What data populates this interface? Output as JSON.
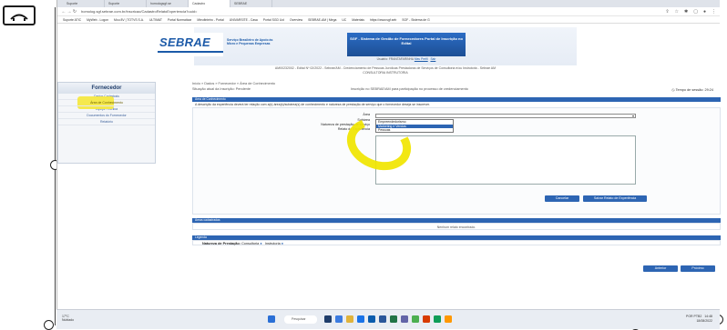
{
  "browser": {
    "tabs": [
      "Suporte",
      "Suporte",
      "homologsgf.se",
      "Cadastro",
      "SEBRAE"
    ],
    "url": "homolog.sgf.sebrae.com.br/inscricao/CadastroRelatoExperiencia?uuid=",
    "bookmarks": [
      "Suporte ATIC",
      "MyWeb - Logon",
      "Mou 8V | TOTVS S.A.",
      "ULTIMAT",
      "Portal Normatizar",
      "Mieufinteiro - Portal",
      "UNIVARSITE - Casa",
      "Portal SGD Uol",
      "Overview",
      "SEBRAE-AM | Mega",
      "UC",
      "Materiais",
      "https://www.sgf.seb",
      "SGF - Sistema de G"
    ]
  },
  "header": {
    "logo": "SEBRAE",
    "logo_tagline": "Serviço Brasileiro de Apoio às Micro e Pequenas Empresas",
    "sgf_title": "SGF - Sistema de Gestão de Fornecedores Portal de Inscrição no Edital",
    "user_label": "Usuário: FRANTAFARINHA",
    "user_link": "Meu Perfil",
    "exit_link": "Sair",
    "edital": "AM00232002 - Edital Nº 02/2022 - Sebrae/AM - Credenciamento de Pessoas Jurídicas Prestadoras de Serviços de Consultoria e/ou Instrutoria - Sebrae AM",
    "edital_sub": "CONSULTORIA INSTRUTORIA"
  },
  "sidebar": {
    "title": "Fornecedor",
    "items": [
      "Dados Cadastrais",
      "Área de Conhecimento",
      "Equipe Técnica",
      "Documentos do Fornecedor",
      "Relatório"
    ]
  },
  "content": {
    "breadcrumb": "Início » Dados » Fornecedor » Área de Conhecimento",
    "status": "Situação atual da Inscrição: Pendente",
    "status_mid": "Inscrição no SEBRAE/AM para participação no processo de credenciamento",
    "timer": "Tempo de sessão: 29:24",
    "section_title": "Área de Conhecimento",
    "section_desc": "A descrição da experiência deverá ter relação com a(s) área(s)/subárea(s) de conhecimento e natureza de prestação de serviço que o fornecedor deseja se inscrever.",
    "labels": {
      "area": "Área",
      "subarea": "Subárea",
      "natureza": "Natureza de prestação de serviço",
      "relato": "Relato de Experiência"
    },
    "options": [
      "Empreendedorismo",
      "Marketing e Vendas",
      "Pessoas"
    ],
    "selected_option": "Marketing e Vendas",
    "cancel_label": "Cancelar",
    "save_label": "Salvar Relato de Experiência",
    "list_title": "Áreas cadastradas",
    "no_results": "Nenhum relato encontrado.",
    "legend_title": "Legenda",
    "legend_text": "Natureza de Prestação:",
    "legend_consultoria": "Consultoria",
    "legend_instrutoria": "Instrutoria",
    "prev_label": "Anterior",
    "next_label": "Próximo"
  },
  "taskbar": {
    "weather_temp": "17°C",
    "weather_desc": "Nublado",
    "search_label": "Pesquisar",
    "lang": "POR PTB2",
    "time": "14:48",
    "date": "18/08/2022"
  }
}
